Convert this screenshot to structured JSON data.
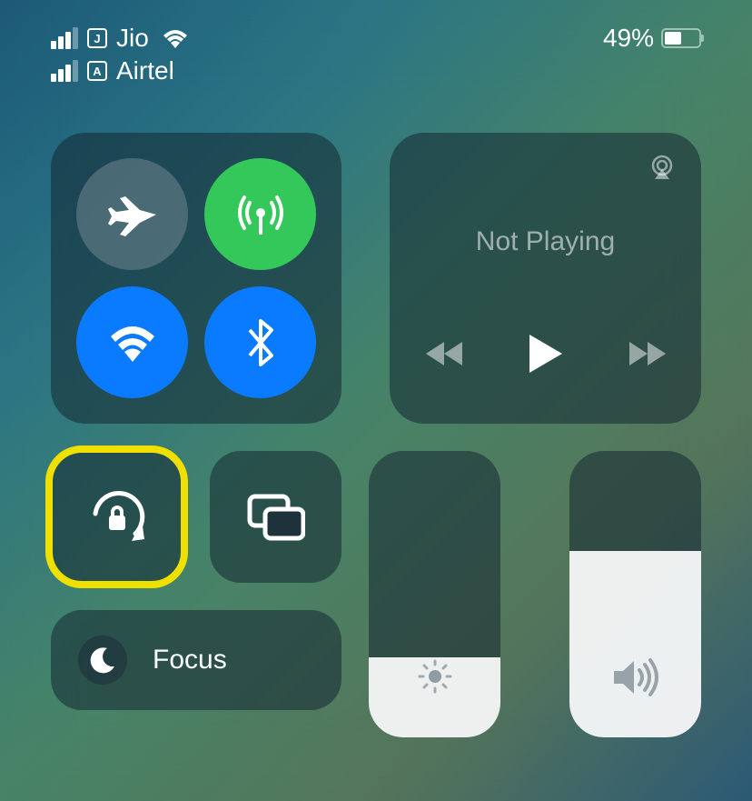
{
  "status": {
    "sim1": {
      "bars": 3,
      "letter": "J",
      "carrier": "Jio",
      "wifi": true
    },
    "sim2": {
      "bars": 3,
      "letter": "A",
      "carrier": "Airtel"
    },
    "battery": {
      "percent_label": "49%",
      "percent": 49
    }
  },
  "media": {
    "title": "Not Playing"
  },
  "focus": {
    "label": "Focus"
  },
  "sliders": {
    "brightness": {
      "level_percent": 28
    },
    "volume": {
      "level_percent": 65
    }
  },
  "toggles": {
    "airplane": false,
    "cellular": true,
    "wifi": true,
    "bluetooth": true,
    "rotation_lock": false
  },
  "highlight": "rotation-lock"
}
